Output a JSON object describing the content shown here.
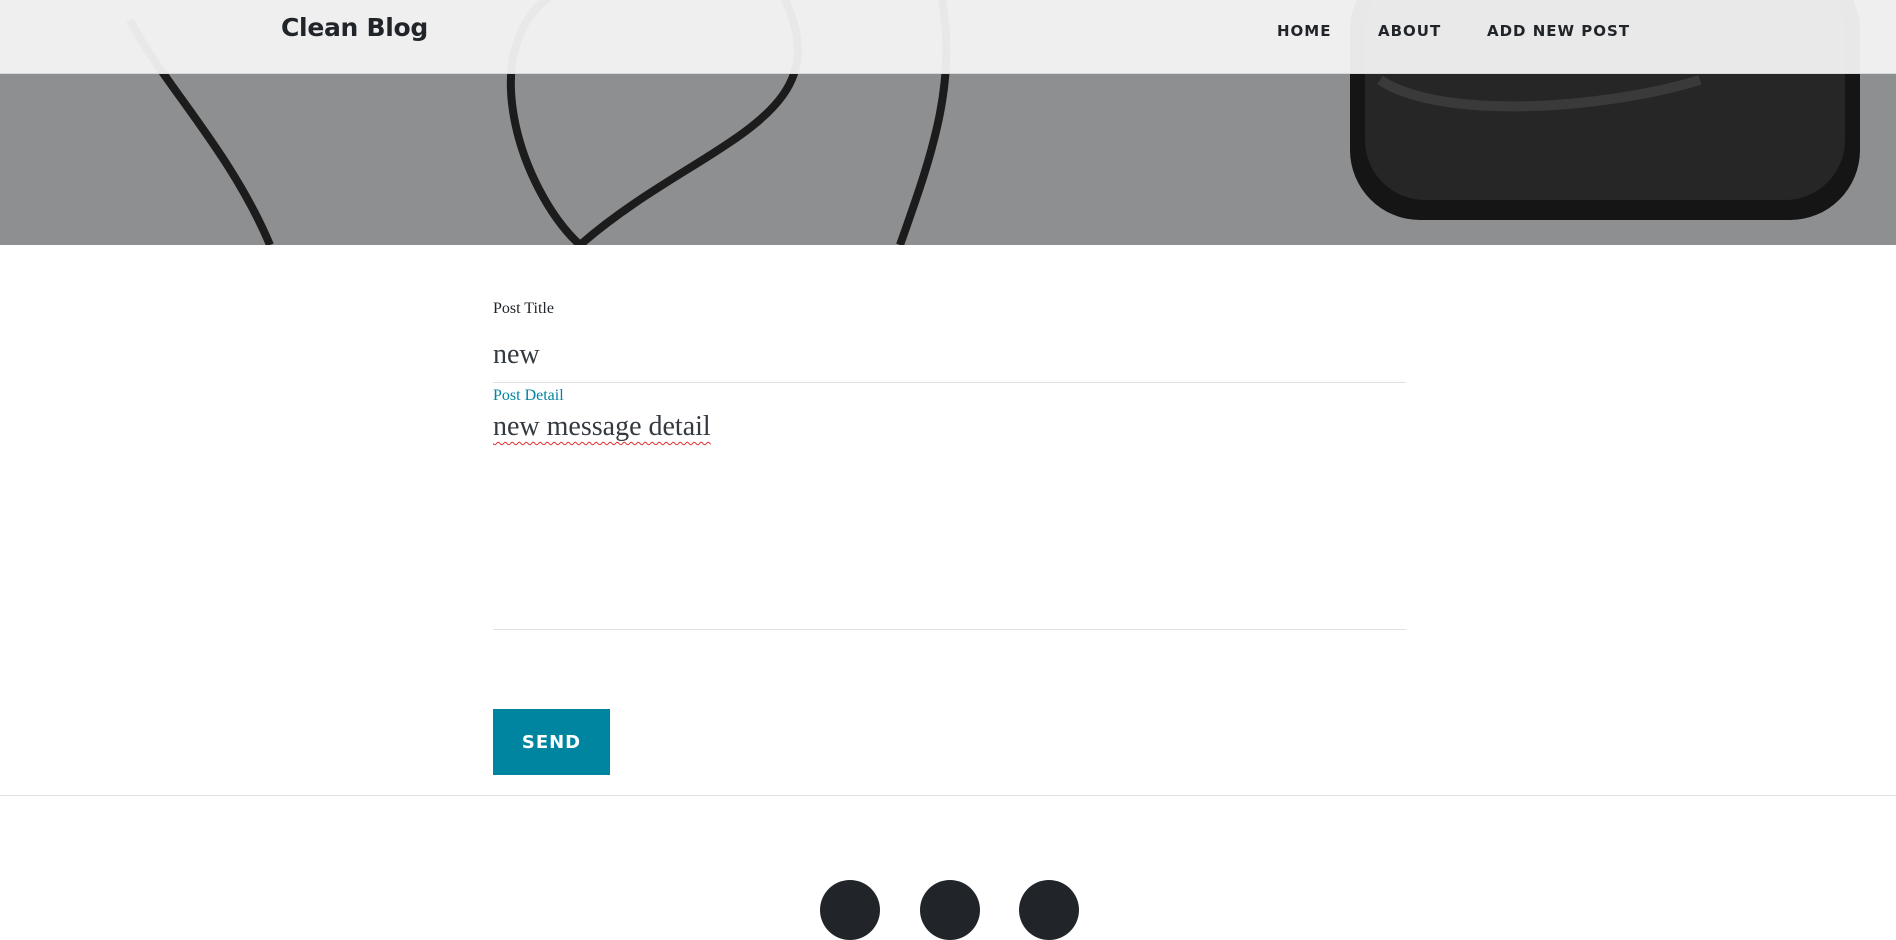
{
  "navbar": {
    "brand": "Clean Blog",
    "links": [
      {
        "label": "Home"
      },
      {
        "label": "About"
      },
      {
        "label": "Add New Post"
      }
    ]
  },
  "form": {
    "title_label": "Post Title",
    "title_value": "new",
    "detail_label": "Post Detail",
    "detail_value": "new message detail",
    "send_label": "Send"
  },
  "footer": {
    "social_icons": [
      "social-icon",
      "social-icon",
      "social-icon"
    ]
  },
  "colors": {
    "accent": "#0085a1",
    "text": "#212529",
    "header_bg": "#8c8d8f"
  }
}
